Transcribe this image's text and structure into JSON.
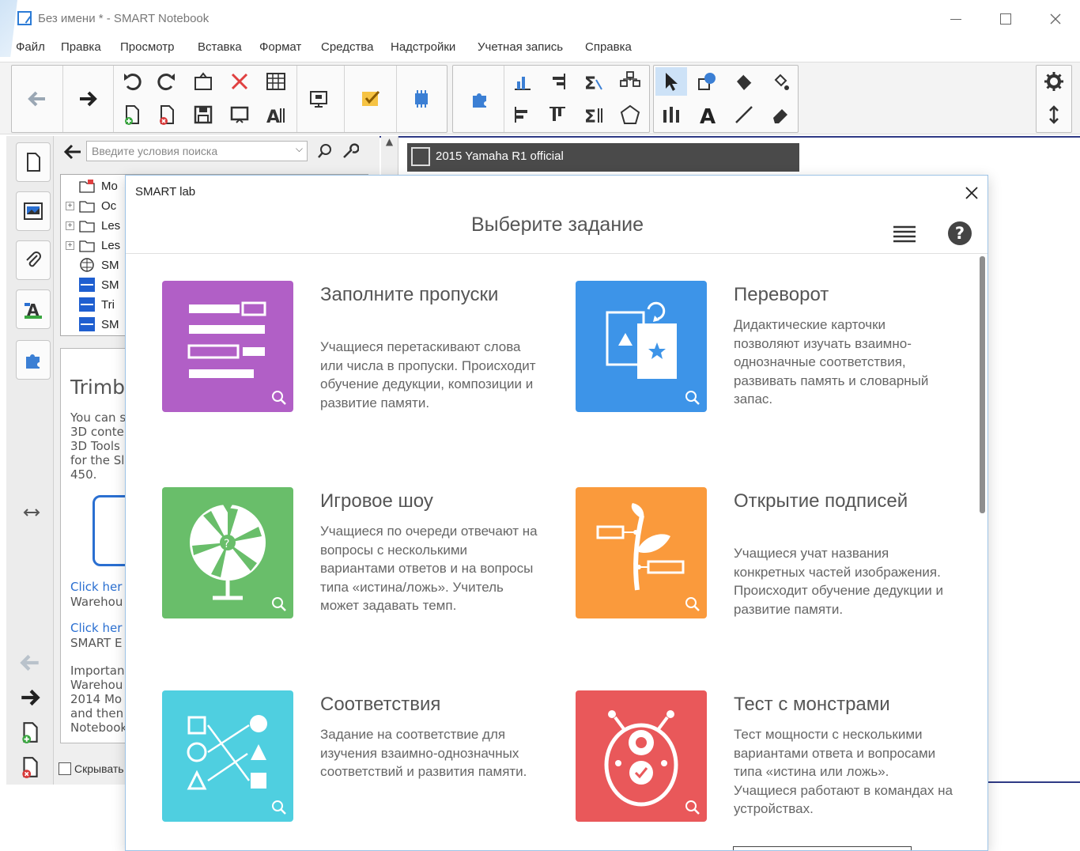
{
  "window": {
    "title": "Без имени * - SMART Notebook"
  },
  "menubar": {
    "items": [
      "Файл",
      "Правка",
      "Просмотр",
      "Вставка",
      "Формат",
      "Средства",
      "Надстройки",
      "Учетная запись",
      "Справка"
    ]
  },
  "sidepanel": {
    "search_placeholder": "Введите условия поиска",
    "tree": [
      {
        "label": "Mo",
        "icon": "calendar-folder-icon",
        "expand": false
      },
      {
        "label": "Oc",
        "icon": "folder-icon",
        "expand": true
      },
      {
        "label": "Les",
        "icon": "folder-icon",
        "expand": true
      },
      {
        "label": "Les",
        "icon": "folder-icon",
        "expand": true
      },
      {
        "label": "SM",
        "icon": "globe-icon",
        "expand": false
      },
      {
        "label": "SM",
        "icon": "smart-file-icon",
        "expand": false
      },
      {
        "label": "Tri",
        "icon": "smart-file-icon",
        "expand": false
      },
      {
        "label": "SM",
        "icon": "smart-file-icon",
        "expand": false
      }
    ],
    "info": {
      "title": "Trimb",
      "text": "You can s\n3D conte\n3D Tools\nfor the Sl\n450.",
      "link1": "Click her",
      "sub1": "Warehou",
      "link2": "Click her",
      "sub2": "SMART E",
      "sub3": "Importan\nWarehou\n2014 Mo\nand then\nNotebook"
    },
    "hide_label": "Скрывать"
  },
  "canvas": {
    "video_title": "2015 Yamaha R1 official"
  },
  "dialog": {
    "title": "SMART lab",
    "heading": "Выберите задание",
    "cards": [
      {
        "title": "Заполните пропуски",
        "description": "Учащиеся перетаскивают слова или числа в пропуски. Происходит обучение дедукции, композиции и развитие памяти.",
        "color": "#b15fc6"
      },
      {
        "title": "Переворот",
        "description": "Дидактические карточки позволяют изучать взаимно-однозначные соответствия, развивать память и словарный запас.",
        "color": "#3d94e8"
      },
      {
        "title": "Игровое шоу",
        "description": "Учащиеся по очереди отвечают на вопросы с несколькими вариантами ответов и на вопросы типа «истина/ложь». Учитель может задавать темп.",
        "color": "#69be6a"
      },
      {
        "title": "Открытие подписей",
        "description": "Учащиеся учат названия конкретных частей изображения. Происходит обучение дедукции и развитие памяти.",
        "color": "#fa9a3c"
      },
      {
        "title": "Соответствия",
        "description": "Задание на соответствие для изучения взаимно-однозначных соответствий и развития памяти.",
        "color": "#4fcfe0"
      },
      {
        "title": "Тест с монстрами",
        "description": "Тест мощности с несколькими вариантами ответа и вопросами типа «истина или ложь». Учащиеся работают в командах на устройствах.",
        "color": "#e9585a"
      }
    ]
  }
}
